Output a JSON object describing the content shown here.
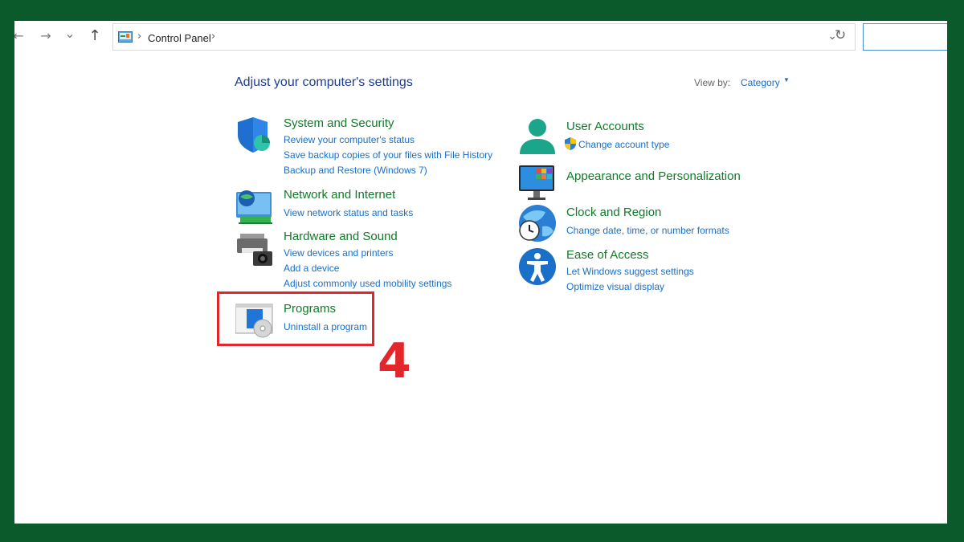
{
  "toolbar": {
    "back_icon": "←",
    "forward_icon": "→",
    "history_icon": "⌄",
    "up_icon": "↑",
    "breadcrumb": [
      "Control Panel"
    ],
    "crumb_sep": "›",
    "dropdown_icon": "⌄",
    "refresh_icon": "↻"
  },
  "header": {
    "title": "Adjust your computer's settings",
    "view_by_label": "View by:",
    "view_by_value": "Category",
    "view_by_caret": "▼"
  },
  "categories": {
    "system": {
      "title": "System and Security",
      "links": [
        "Review your computer's status",
        "Save backup copies of your files with File History",
        "Backup and Restore (Windows 7)"
      ]
    },
    "network": {
      "title": "Network and Internet",
      "links": [
        "View network status and tasks"
      ]
    },
    "hardware": {
      "title": "Hardware and Sound",
      "links": [
        "View devices and printers",
        "Add a device",
        "Adjust commonly used mobility settings"
      ]
    },
    "programs": {
      "title": "Programs",
      "links": [
        "Uninstall a program"
      ]
    },
    "users": {
      "title": "User Accounts",
      "links": [
        "Change account type"
      ]
    },
    "appearance": {
      "title": "Appearance and Personalization",
      "links": []
    },
    "clock": {
      "title": "Clock and Region",
      "links": [
        "Change date, time, or number formats"
      ]
    },
    "ease": {
      "title": "Ease of Access",
      "links": [
        "Let Windows suggest settings",
        "Optimize visual display"
      ]
    }
  },
  "annotation": {
    "step": "4",
    "color": "#e3262c"
  },
  "colors": {
    "frame": "#0b5a2c",
    "title_green": "#127a2a",
    "link_blue": "#1a6fc9",
    "header_blue": "#1e3d8f"
  },
  "icons": {
    "system": "shield-icon",
    "network": "network-globe-icon",
    "hardware": "printer-camera-icon",
    "programs": "programs-disc-icon",
    "users": "user-icon",
    "appearance": "monitor-palette-icon",
    "clock": "globe-clock-icon",
    "ease": "accessibility-icon"
  }
}
